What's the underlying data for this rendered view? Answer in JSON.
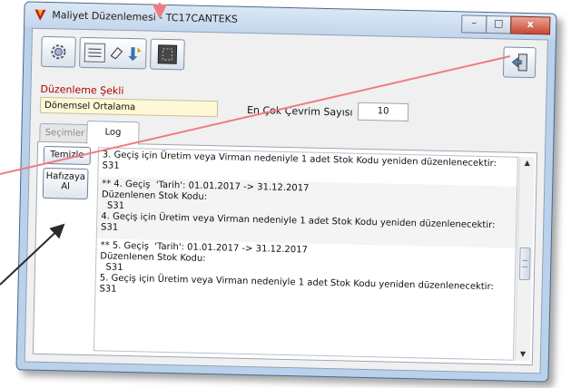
{
  "window": {
    "title": "Maliyet Düzenlemesi - TC17CANTEKS",
    "controls": {
      "minimize": "–",
      "maximize": "□",
      "close": "x"
    }
  },
  "toolbar": {
    "items": [
      "gear-icon",
      "list-icon",
      "eraser-icon",
      "import-icon",
      "grid-icon"
    ],
    "exit_icon": "exit-door-icon"
  },
  "form": {
    "edit_mode_label": "Düzenleme Şekli",
    "edit_mode_value": "Dönemsel Ortalama",
    "max_cycles_label": "En Çok Çevrim Sayısı",
    "max_cycles_value": "10"
  },
  "tabs": [
    {
      "label": "Seçimler",
      "active": false
    },
    {
      "label": "Log",
      "active": true
    }
  ],
  "buttons": {
    "clear": "Temizle",
    "copy_line1": "Hafızaya",
    "copy_line2": "Al"
  },
  "log": [
    "3. Geçiş için Üretim veya Virman nedeniyle 1 adet Stok Kodu yeniden düzenlenecektir:\nS31",
    "** 4. Geçiş  'Tarih': 01.01.2017 -> 31.12.2017\nDüzenlenen Stok Kodu:\n  S31\n4. Geçiş için Üretim veya Virman nedeniyle 1 adet Stok Kodu yeniden düzenlenecektir:\nS31",
    "** 5. Geçiş  'Tarih': 01.01.2017 -> 31.12.2017\nDüzenlenen Stok Kodu:\n  S31\n5. Geçiş için Üretim veya Virman nedeniyle 1 adet Stok Kodu yeniden düzenlenecektir:\nS31"
  ],
  "colors": {
    "annotation": "#f07a80",
    "arrow": "#2a2a2a",
    "label_red": "#b00000",
    "field_yellow": "#fff8d6"
  }
}
